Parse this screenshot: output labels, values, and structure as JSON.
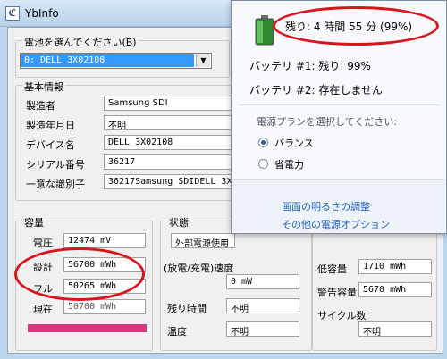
{
  "window": {
    "title": "YbInfo",
    "icon": "yb-app-icon"
  },
  "battery_select": {
    "label": "電池を選んでください(B)",
    "value": "0: DELL 3X02108"
  },
  "basic_info": {
    "legend": "基本情報",
    "rows": [
      {
        "label": "製造者",
        "value": "Samsung SDI"
      },
      {
        "label": "製造年月日",
        "value": "不明"
      },
      {
        "label": "デバイス名",
        "value": "DELL 3X02108"
      },
      {
        "label": "シリアル番号",
        "value": "36217"
      },
      {
        "label": "一意な識別子",
        "value": "36217Samsung SDIDELL 3X"
      }
    ]
  },
  "capacity": {
    "legend": "容量",
    "voltage_label": "電圧",
    "voltage_value": "12474 mV",
    "design_label": "設計",
    "design_value": "56700 mWh",
    "full_label": "フル",
    "full_value": "50265 mWh",
    "current_label": "現在",
    "current_value": "50700 mWh",
    "bar_color": "#d8377e"
  },
  "status": {
    "legend": "状態",
    "power_value": "外部電源使用",
    "rate_label": "(放電/充電)速度",
    "rate_value": "0 mW",
    "remaining_label": "残り時間",
    "remaining_value": "不明",
    "temp_label": "温度",
    "temp_value": "不明"
  },
  "right_panel": {
    "low_label": "低容量",
    "low_value": "1710 mWh",
    "warn_label": "警告容量",
    "warn_value": "5670 mWh",
    "cycle_label": "サイクル数",
    "cycle_value": "不明"
  },
  "popup": {
    "remaining": "残り: 4 時間 55 分 (99%)",
    "battery1": "バッテリ #1: 残り: 99%",
    "battery2": "バッテリ #2: 存在しません",
    "plan_prompt": "電源プランを選択してください:",
    "plans": [
      {
        "label": "バランス",
        "selected": true
      },
      {
        "label": "省電力",
        "selected": false
      }
    ],
    "link_brightness": "画面の明るさの調整",
    "link_more": "その他の電源オプション",
    "battery_icon": "battery-full-icon"
  },
  "annotation_color": "#d8141d"
}
